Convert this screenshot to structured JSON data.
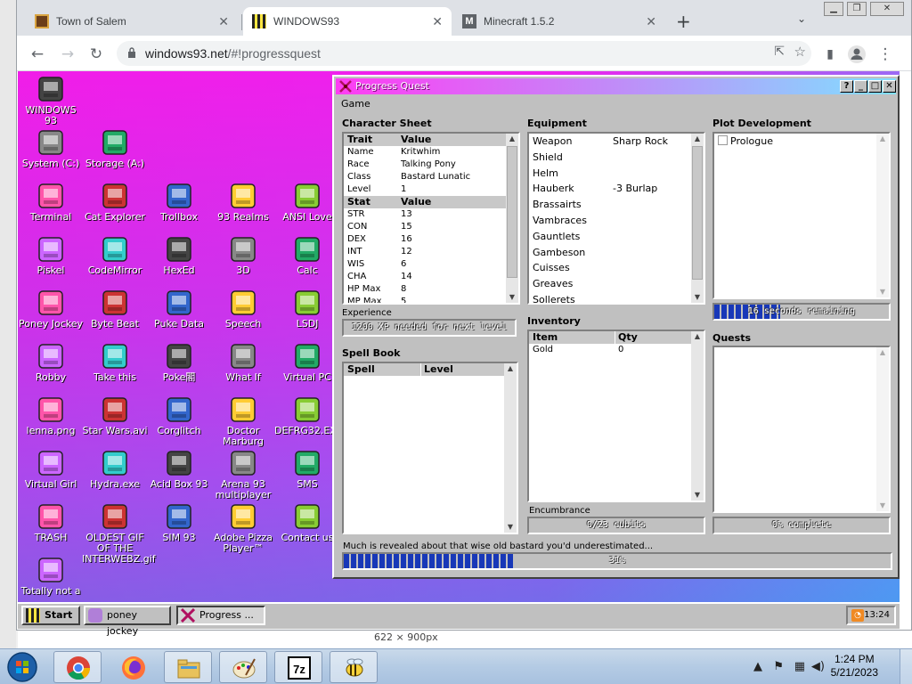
{
  "browser": {
    "tabs": [
      {
        "title": "Town of Salem",
        "active": false
      },
      {
        "title": "WINDOWS93",
        "active": true
      },
      {
        "title": "Minecraft 1.5.2",
        "active": false
      }
    ],
    "url_host": "windows93.net",
    "url_path": "/#!progressquest",
    "new_tab": "+",
    "tab_menu": "⌄"
  },
  "desktop_icons": [
    {
      "label": "WINDOWS 93",
      "icon": "computer-icon"
    },
    {
      "label": "System (C:)",
      "icon": "drive-icon"
    },
    {
      "label": "Storage (A:)",
      "icon": "floppy-drive-icon"
    },
    {
      "label": "Terminal",
      "icon": "terminal-icon"
    },
    {
      "label": "Cat Explorer",
      "icon": "globe-cat-icon"
    },
    {
      "label": "Trollbox",
      "icon": "chat-bubble-icon"
    },
    {
      "label": "93 Realms",
      "icon": "mage-icon"
    },
    {
      "label": "ANSI Love",
      "icon": "ansi-letter-icon"
    },
    {
      "label": "Piskel",
      "icon": "palette-icon"
    },
    {
      "label": "CodeMirror",
      "icon": "code-cat-icon"
    },
    {
      "label": "HexEd",
      "icon": "cube-icon"
    },
    {
      "label": "3D",
      "icon": "teapot-icon"
    },
    {
      "label": "Calc",
      "icon": "calculator-icon"
    },
    {
      "label": "Poney Jockey",
      "icon": "pony-icon"
    },
    {
      "label": "Byte Beat",
      "icon": "bytebeat-icon"
    },
    {
      "label": "Puke Data",
      "icon": "pd-icon"
    },
    {
      "label": "Speech",
      "icon": "speech-face-icon"
    },
    {
      "label": "LSDJ",
      "icon": "lsdj-icon"
    },
    {
      "label": "Robby",
      "icon": "stick-figure-icon"
    },
    {
      "label": "Take this",
      "icon": "take-this-icon"
    },
    {
      "label": "Poke閣",
      "icon": "pokemon-icon"
    },
    {
      "label": "What If",
      "icon": "what-if-icon"
    },
    {
      "label": "Virtual PC",
      "icon": "virtual-pc-icon"
    },
    {
      "label": "lenna.png",
      "icon": "image-file-icon"
    },
    {
      "label": "Star Wars.avi",
      "icon": "yoda-icon"
    },
    {
      "label": "Corglitch",
      "icon": "corgi-icon"
    },
    {
      "label": "Doctor Marburg",
      "icon": "doctor-icon"
    },
    {
      "label": "DEFRG32.EXE",
      "icon": "defrag-icon"
    },
    {
      "label": "Virtual Girl",
      "icon": "girl-face-icon"
    },
    {
      "label": "Hydra.exe",
      "icon": "dragon-icon"
    },
    {
      "label": "Acid Box 93",
      "icon": "smiley-icon"
    },
    {
      "label": "Arena 93 multiplayer",
      "icon": "arena-cube-icon"
    },
    {
      "label": "SMS",
      "icon": "console-icon"
    },
    {
      "label": "TRASH",
      "icon": "trash-icon"
    },
    {
      "label": "OLDEST GIF OF THE INTERWEBZ.gif",
      "icon": "gif-file-icon"
    },
    {
      "label": "SIM 93",
      "icon": "book-icon"
    },
    {
      "label": "Adobe Pizza Player™",
      "icon": "pizza-icon"
    },
    {
      "label": "Contact us",
      "icon": "contact-icon"
    },
    {
      "label": "Totally not a",
      "icon": "dolphin-shortcut-icon"
    }
  ],
  "pq": {
    "title": "Progress Quest",
    "buttons": {
      "help": "?",
      "minimize": "_",
      "maximize": "□",
      "close": "✕"
    },
    "menu": "Game",
    "character_sheet": {
      "heading": "Character Sheet",
      "trait_header": [
        "Trait",
        "Value"
      ],
      "traits": [
        [
          "Name",
          "Kritwhim"
        ],
        [
          "Race",
          "Talking Pony"
        ],
        [
          "Class",
          "Bastard Lunatic"
        ],
        [
          "Level",
          "1"
        ]
      ],
      "stat_header": [
        "Stat",
        "Value"
      ],
      "stats": [
        [
          "STR",
          "13"
        ],
        [
          "CON",
          "15"
        ],
        [
          "DEX",
          "16"
        ],
        [
          "INT",
          "12"
        ],
        [
          "WIS",
          "6"
        ],
        [
          "CHA",
          "14"
        ],
        [
          "HP Max",
          "8"
        ],
        [
          "MP Max",
          "5"
        ]
      ]
    },
    "experience": {
      "label": "Experience",
      "text": "1200 XP needed for next level",
      "progress": 0
    },
    "spell_book": {
      "heading": "Spell Book",
      "header": [
        "Spell",
        "Level"
      ]
    },
    "equipment": {
      "heading": "Equipment",
      "items": [
        [
          "Weapon",
          "Sharp Rock"
        ],
        [
          "Shield",
          ""
        ],
        [
          "Helm",
          ""
        ],
        [
          "Hauberk",
          "-3 Burlap"
        ],
        [
          "Brassairts",
          ""
        ],
        [
          "Vambraces",
          ""
        ],
        [
          "Gauntlets",
          ""
        ],
        [
          "Gambeson",
          ""
        ],
        [
          "Cuisses",
          ""
        ],
        [
          "Greaves",
          ""
        ],
        [
          "Sollerets",
          ""
        ]
      ]
    },
    "inventory": {
      "heading": "Inventory",
      "header": [
        "Item",
        "Qty"
      ],
      "items": [
        [
          "Gold",
          "0"
        ]
      ]
    },
    "encumbrance": {
      "label": "Encumbrance",
      "text": "0/23 cubits",
      "progress": 0
    },
    "plot": {
      "heading": "Plot Development",
      "items": [
        "Prologue"
      ],
      "bar_text": "16 seconds remaining",
      "progress": 0.38
    },
    "quests": {
      "heading": "Quests",
      "bar_text": "0% complete",
      "progress": 0
    },
    "status": {
      "text": "Much is revealed about that wise old bastard you'd underestimated...",
      "bar_text": "31%",
      "progress": 0.31
    }
  },
  "w93_taskbar": {
    "start": "Start",
    "items": [
      "poney jockey",
      "Progress ..."
    ],
    "clock": "13:24"
  },
  "win7_taskbar": {
    "apps": [
      "chrome-icon",
      "firefox-icon",
      "explorer-icon",
      "paint-icon",
      "7zip-icon",
      "bee-icon"
    ],
    "time": "1:24 PM",
    "date": "5/21/2023",
    "behind_text": "622 × 900px"
  },
  "colors": {
    "accent": "#1838b8",
    "desktop_top": "#ee22ee",
    "desktop_bottom": "#6e6fe8"
  }
}
